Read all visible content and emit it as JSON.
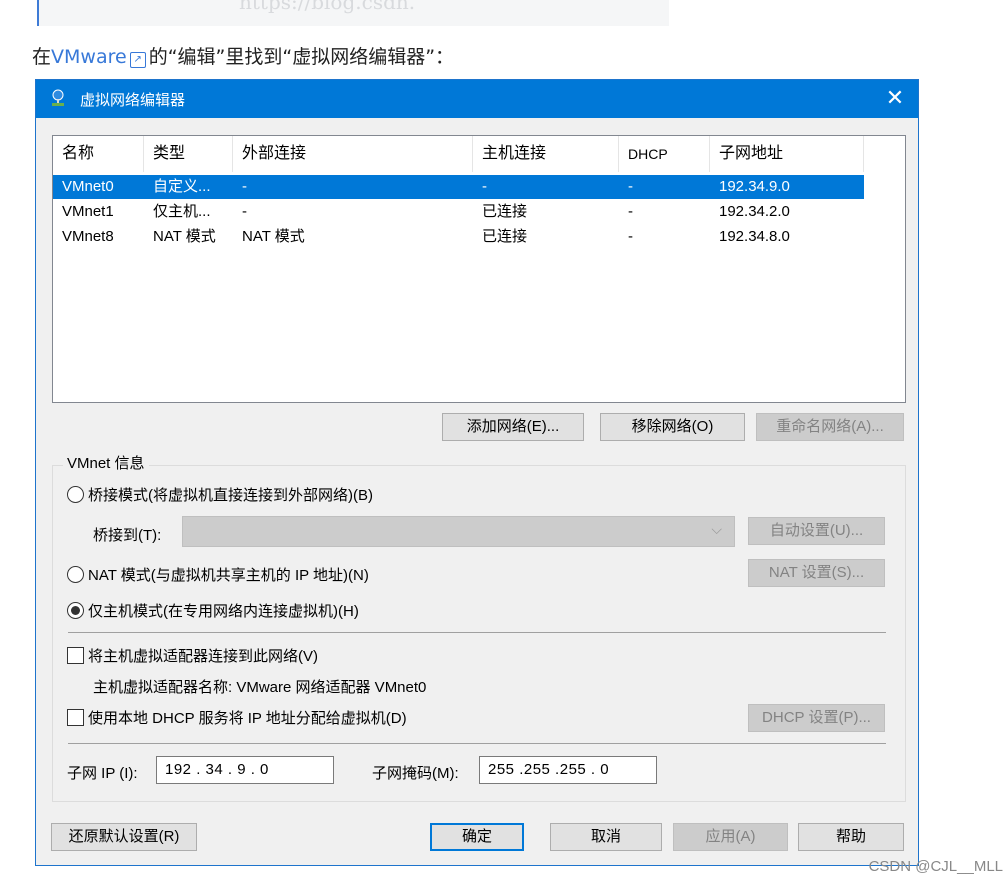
{
  "intro": {
    "prefix": "在",
    "link": "VMware",
    "suffix": "的“编辑”里找到“虚拟网络编辑器”："
  },
  "dialog": {
    "title": "虚拟网络编辑器",
    "close": "✕",
    "columns": [
      "名称",
      "类型",
      "外部连接",
      "主机连接",
      "DHCP",
      "子网地址"
    ],
    "rows": [
      {
        "name": "VMnet0",
        "type": "自定义...",
        "external": "-",
        "host": "-",
        "dhcp": "-",
        "subnet": "192.34.9.0",
        "selected": true
      },
      {
        "name": "VMnet1",
        "type": "仅主机...",
        "external": "-",
        "host": "已连接",
        "dhcp": "-",
        "subnet": "192.34.2.0",
        "selected": false
      },
      {
        "name": "VMnet8",
        "type": "NAT 模式",
        "external": "NAT 模式",
        "host": "已连接",
        "dhcp": "-",
        "subnet": "192.34.8.0",
        "selected": false
      }
    ],
    "buttons": {
      "add": "添加网络(E)...",
      "remove": "移除网络(O)",
      "rename": "重命名网络(A)..."
    },
    "group": {
      "legend": "VMnet 信息",
      "bridge_radio": "桥接模式(将虚拟机直接连接到外部网络)(B)",
      "bridge_to_label": "桥接到(T):",
      "auto_setup": "自动设置(U)...",
      "nat_radio": "NAT 模式(与虚拟机共享主机的 IP 地址)(N)",
      "nat_settings": "NAT 设置(S)...",
      "host_only_radio": "仅主机模式(在专用网络内连接虚拟机)(H)",
      "connect_adapter": "将主机虚拟适配器连接到此网络(V)",
      "adapter_name": "主机虚拟适配器名称: VMware 网络适配器 VMnet0",
      "use_dhcp": "使用本地 DHCP 服务将 IP 地址分配给虚拟机(D)",
      "dhcp_settings": "DHCP 设置(P)...",
      "subnet_ip_label": "子网 IP (I):",
      "subnet_ip": "192 . 34  .  9  .  0",
      "subnet_mask_label": "子网掩码(M):",
      "subnet_mask": "255 .255 .255 .  0"
    },
    "footer": {
      "restore": "还原默认设置(R)",
      "ok": "确定",
      "cancel": "取消",
      "apply": "应用(A)",
      "help": "帮助"
    }
  },
  "credit": "CSDN @CJL__MLL"
}
